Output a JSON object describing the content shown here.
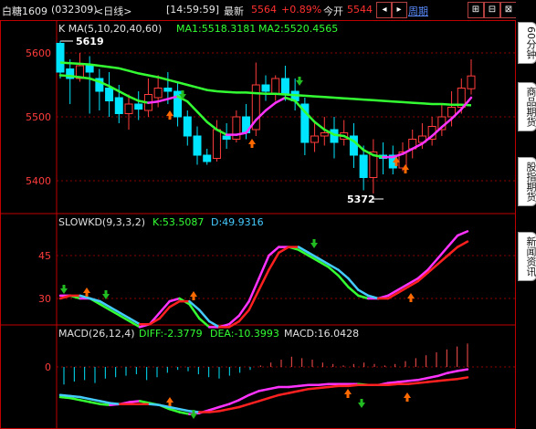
{
  "topbar": {
    "title": "白糖1609",
    "code": "(032309)",
    "period": "<日线>",
    "time": "[14:59:59]",
    "latest_label": "最新",
    "latest_value": "5564",
    "change": "+0.89%",
    "open_label": "今开",
    "open_value": "5544",
    "period_link": "周期"
  },
  "main_panel": {
    "ma_label": "K  MA(5,10,20,40,60)",
    "ma1_text": "MA1:5518.3181",
    "ma2_text": "MA2:5520.4565",
    "y_ticks": [
      "5600",
      "5500",
      "5400"
    ],
    "high_label": "5619",
    "low_label": "5372"
  },
  "kd_panel": {
    "label": "SLOWKD(9,3,3,2)",
    "k_text": "K:53.5087",
    "d_text": "D:49.9316",
    "y_ticks": [
      "45",
      "30"
    ]
  },
  "macd_panel": {
    "label": "MACD(26,12,4)",
    "diff_text": "DIFF:-2.3779",
    "dea_text": "DEA:-10.3993",
    "macd_text": "MACD:16.0428",
    "y_ticks": [
      "0"
    ]
  },
  "sidebar": {
    "tabs": [
      "60分钟",
      "商品期货",
      "股指期货",
      "新闻资讯"
    ]
  },
  "colors": {
    "up": "#ff3c3c",
    "down": "#00e5ff",
    "ma_green": "#33ff33",
    "ma_magenta": "#ff33ff",
    "kd_blue": "#44ccff",
    "kd_red": "#ff2020",
    "grid_red": "#c00000",
    "arrow_orange": "#ff6a00",
    "arrow_green": "#22bb22"
  },
  "chart_data": [
    {
      "type": "candlestick",
      "title": "K  MA(5,10,20,40,60)",
      "ylim": [
        5360,
        5640
      ],
      "high_marker": 5619,
      "low_marker": 5372,
      "candles": [
        [
          5615,
          5570,
          5619,
          5560
        ],
        [
          5575,
          5560,
          5590,
          5520
        ],
        [
          5560,
          5580,
          5600,
          5555
        ],
        [
          5580,
          5570,
          5595,
          5505
        ],
        [
          5560,
          5540,
          5575,
          5510
        ],
        [
          5545,
          5525,
          5570,
          5500
        ],
        [
          5530,
          5505,
          5550,
          5490
        ],
        [
          5505,
          5520,
          5535,
          5480
        ],
        [
          5520,
          5512,
          5540,
          5495
        ],
        [
          5510,
          5535,
          5560,
          5500
        ],
        [
          5530,
          5545,
          5565,
          5515
        ],
        [
          5545,
          5540,
          5570,
          5520
        ],
        [
          5540,
          5500,
          5555,
          5485
        ],
        [
          5500,
          5470,
          5510,
          5455
        ],
        [
          5470,
          5440,
          5485,
          5425
        ],
        [
          5440,
          5430,
          5450,
          5425
        ],
        [
          5435,
          5480,
          5495,
          5430
        ],
        [
          5470,
          5465,
          5490,
          5450
        ],
        [
          5465,
          5500,
          5510,
          5460
        ],
        [
          5500,
          5475,
          5520,
          5465
        ],
        [
          5480,
          5550,
          5585,
          5470
        ],
        [
          5550,
          5540,
          5565,
          5525
        ],
        [
          5535,
          5560,
          5565,
          5525
        ],
        [
          5560,
          5535,
          5580,
          5525
        ],
        [
          5540,
          5525,
          5560,
          5510
        ],
        [
          5520,
          5460,
          5530,
          5440
        ],
        [
          5460,
          5470,
          5490,
          5445
        ],
        [
          5470,
          5475,
          5500,
          5455
        ],
        [
          5480,
          5460,
          5500,
          5435
        ],
        [
          5465,
          5475,
          5495,
          5455
        ],
        [
          5470,
          5440,
          5490,
          5420
        ],
        [
          5440,
          5405,
          5455,
          5385
        ],
        [
          5405,
          5445,
          5465,
          5380
        ],
        [
          5440,
          5435,
          5460,
          5410
        ],
        [
          5440,
          5420,
          5455,
          5410
        ],
        [
          5420,
          5445,
          5460,
          5415
        ],
        [
          5450,
          5465,
          5480,
          5435
        ],
        [
          5460,
          5470,
          5490,
          5450
        ],
        [
          5465,
          5485,
          5500,
          5455
        ],
        [
          5480,
          5500,
          5520,
          5470
        ],
        [
          5500,
          5515,
          5540,
          5485
        ],
        [
          5515,
          5545,
          5560,
          5505
        ],
        [
          5544,
          5564,
          5590,
          5535
        ]
      ],
      "ma_short": [
        5565,
        5564,
        5562,
        5560,
        5555,
        5548,
        5540,
        5532,
        5525,
        5522,
        5524,
        5528,
        5532,
        5524,
        5508,
        5492,
        5480,
        5472,
        5472,
        5475,
        5495,
        5510,
        5522,
        5530,
        5525,
        5508,
        5492,
        5480,
        5472,
        5470,
        5462,
        5448,
        5440,
        5437,
        5437,
        5442,
        5450,
        5458,
        5470,
        5484,
        5497,
        5512,
        5530
      ],
      "ma_long": [
        5585,
        5584,
        5583,
        5582,
        5580,
        5578,
        5576,
        5572,
        5568,
        5565,
        5562,
        5558,
        5554,
        5550,
        5546,
        5542,
        5540,
        5539,
        5538,
        5538,
        5537,
        5536,
        5536,
        5535,
        5534,
        5533,
        5532,
        5531,
        5530,
        5529,
        5528,
        5527,
        5526,
        5525,
        5524,
        5523,
        5522,
        5521,
        5520,
        5520,
        5519,
        5519,
        5518
      ]
    },
    {
      "type": "line",
      "title": "SLOWKD(9,3,3,2)",
      "ylim": [
        20,
        55
      ],
      "series": [
        {
          "name": "K",
          "values": [
            31,
            31,
            30,
            30,
            28,
            26,
            24,
            22,
            20,
            21,
            25,
            29,
            30,
            28,
            23,
            20,
            20,
            21,
            24,
            29,
            37,
            45,
            48,
            48,
            47,
            45,
            43,
            41,
            38,
            34,
            31,
            30,
            30,
            31,
            33,
            35,
            37,
            40,
            44,
            48,
            52,
            53.5
          ]
        },
        {
          "name": "D",
          "values": [
            30,
            31,
            31,
            30,
            29,
            27,
            25,
            23,
            21,
            21,
            23,
            27,
            29,
            29,
            26,
            22,
            20,
            20,
            22,
            26,
            33,
            40,
            46,
            48,
            48,
            46,
            44,
            42,
            40,
            37,
            33,
            31,
            30,
            30,
            32,
            34,
            36,
            39,
            42,
            45,
            48,
            49.9
          ]
        }
      ]
    },
    {
      "type": "bar",
      "title": "MACD(26,12,4)",
      "macd_bars": [
        -12,
        -10,
        -9,
        -11,
        -8,
        -7,
        -6,
        -5,
        -9,
        -7,
        -4,
        -2,
        -3,
        -5,
        -7,
        -8,
        -6,
        -4,
        -2,
        1,
        3,
        5,
        7,
        6,
        5,
        3,
        2,
        1,
        2,
        3,
        2,
        1,
        2,
        4,
        6,
        8,
        10,
        12,
        14,
        16
      ],
      "series": [
        {
          "name": "DIFF",
          "values": [
            -30,
            -31,
            -33,
            -35,
            -37,
            -38,
            -37,
            -35,
            -34,
            -36,
            -38,
            -42,
            -45,
            -47,
            -46,
            -43,
            -40,
            -37,
            -33,
            -28,
            -24,
            -22,
            -20,
            -20,
            -19,
            -18,
            -18,
            -17,
            -17,
            -17,
            -17,
            -18,
            -18,
            -16,
            -15,
            -14,
            -13,
            -11,
            -9,
            -6,
            -4,
            -2.4
          ]
        },
        {
          "name": "DEA",
          "values": [
            -28,
            -29,
            -30,
            -32,
            -34,
            -36,
            -37,
            -37,
            -37,
            -37,
            -38,
            -40,
            -42,
            -44,
            -45,
            -45,
            -44,
            -42,
            -40,
            -37,
            -34,
            -31,
            -28,
            -26,
            -24,
            -22,
            -21,
            -20,
            -19,
            -19,
            -18,
            -18,
            -18,
            -18,
            -17,
            -17,
            -16,
            -15,
            -14,
            -13,
            -12,
            -10.4
          ]
        }
      ]
    }
  ]
}
